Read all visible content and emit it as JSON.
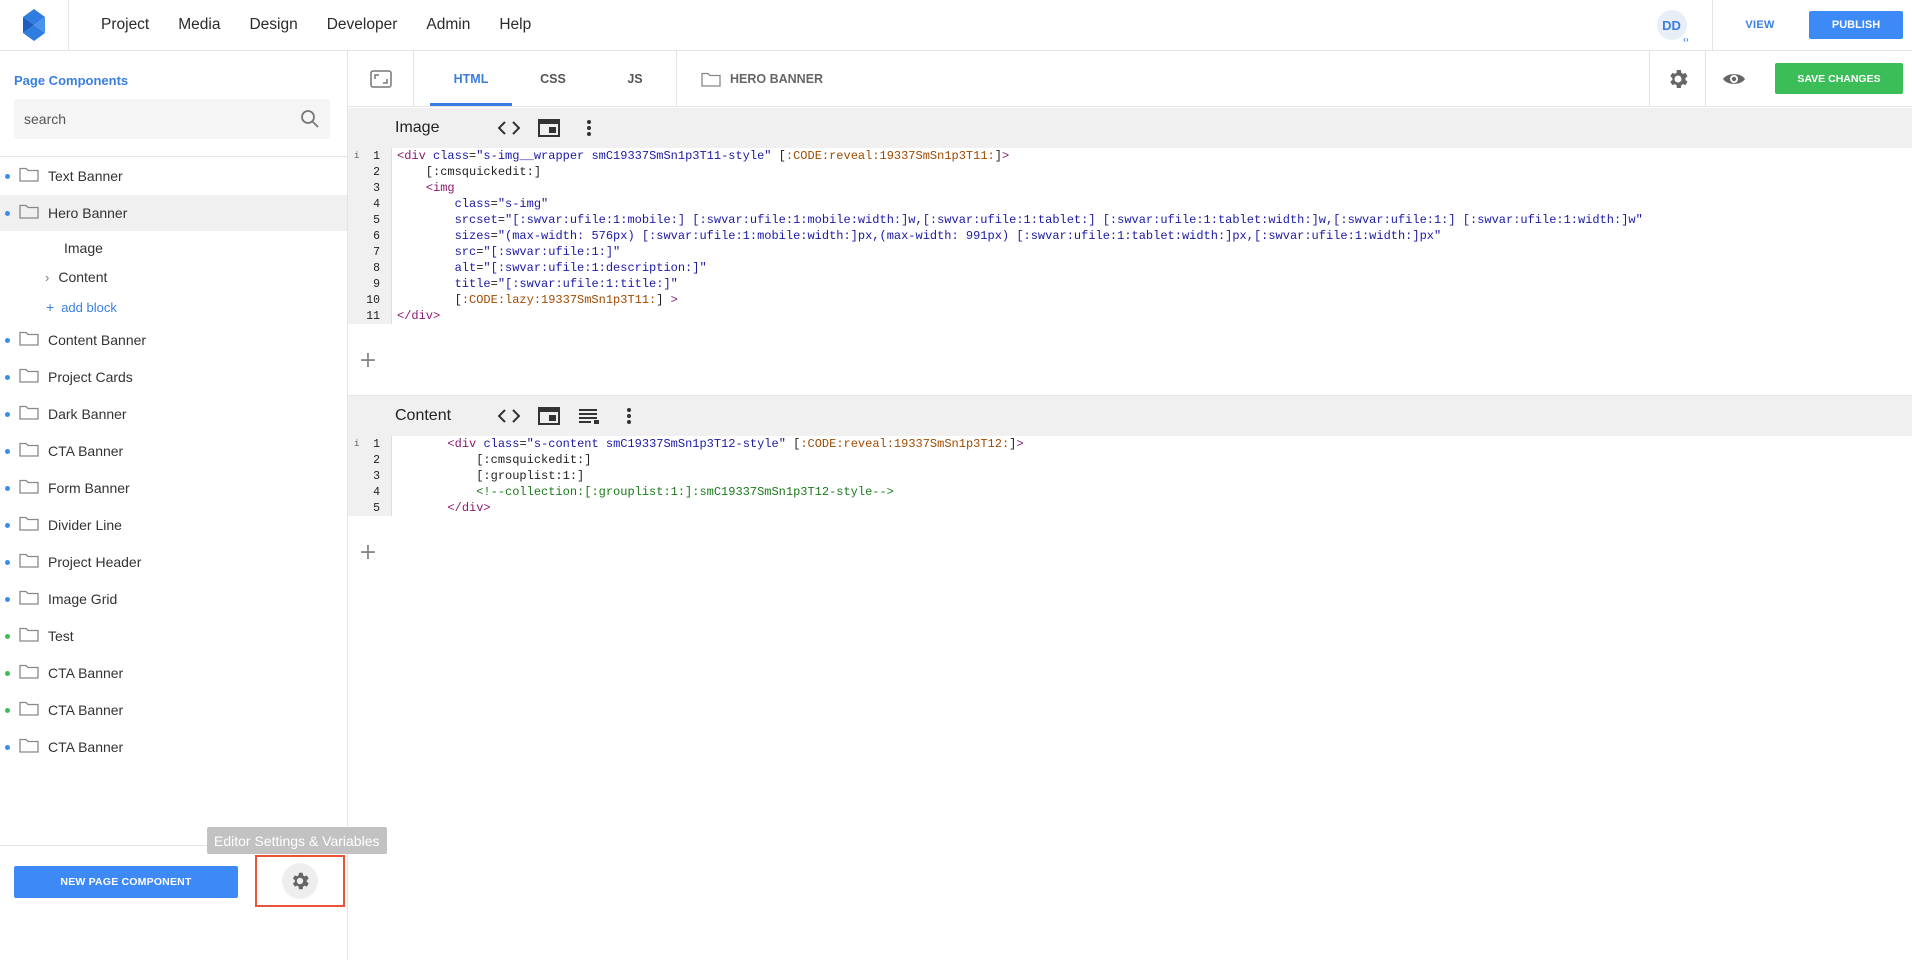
{
  "nav": {
    "items": [
      "Project",
      "Media",
      "Design",
      "Developer",
      "Admin",
      "Help"
    ],
    "avatar_initials": "DD",
    "view_label": "VIEW",
    "publish_label": "PUBLISH"
  },
  "sidebar": {
    "title": "Page Components",
    "search_placeholder": "search",
    "items": [
      {
        "label": "Text Banner",
        "dot": "#3a8ee6"
      },
      {
        "label": "Hero Banner",
        "dot": "#3a8ee6"
      },
      {
        "label": "Content Banner",
        "dot": "#3a8ee6"
      },
      {
        "label": "Project Cards",
        "dot": "#3a8ee6"
      },
      {
        "label": "Dark Banner",
        "dot": "#3a8ee6"
      },
      {
        "label": "CTA Banner",
        "dot": "#3a8ee6"
      },
      {
        "label": "Form Banner",
        "dot": "#3a8ee6"
      },
      {
        "label": "Divider Line",
        "dot": "#3a8ee6"
      },
      {
        "label": "Project Header",
        "dot": "#3a8ee6"
      },
      {
        "label": "Image Grid",
        "dot": "#3a8ee6"
      },
      {
        "label": "Test",
        "dot": "#3bbd57"
      },
      {
        "label": "CTA Banner",
        "dot": "#3bbd57"
      },
      {
        "label": "CTA Banner",
        "dot": "#3bbd57"
      },
      {
        "label": "CTA Banner",
        "dot": "#3a8ee6"
      }
    ],
    "sub_items": {
      "image": "Image",
      "content": "Content",
      "add_block": "add block"
    },
    "new_component_label": "NEW PAGE COMPONENT",
    "tooltip": "Editor Settings & Variables"
  },
  "editor": {
    "tabs": [
      "HTML",
      "CSS",
      "JS"
    ],
    "active_tab": "HTML",
    "breadcrumb": "HERO BANNER",
    "save_label": "SAVE CHANGES",
    "blocks": [
      {
        "title": "Image",
        "lines": [
          "1",
          "2",
          "3",
          "4",
          "5",
          "6",
          "7",
          "8",
          "9",
          "10",
          "11"
        ]
      },
      {
        "title": "Content",
        "lines": [
          "1",
          "2",
          "3",
          "4",
          "5"
        ]
      }
    ]
  },
  "colors": {
    "accent": "#3d8af7",
    "save": "#3bbd57",
    "highlight_box": "#e8533a"
  }
}
